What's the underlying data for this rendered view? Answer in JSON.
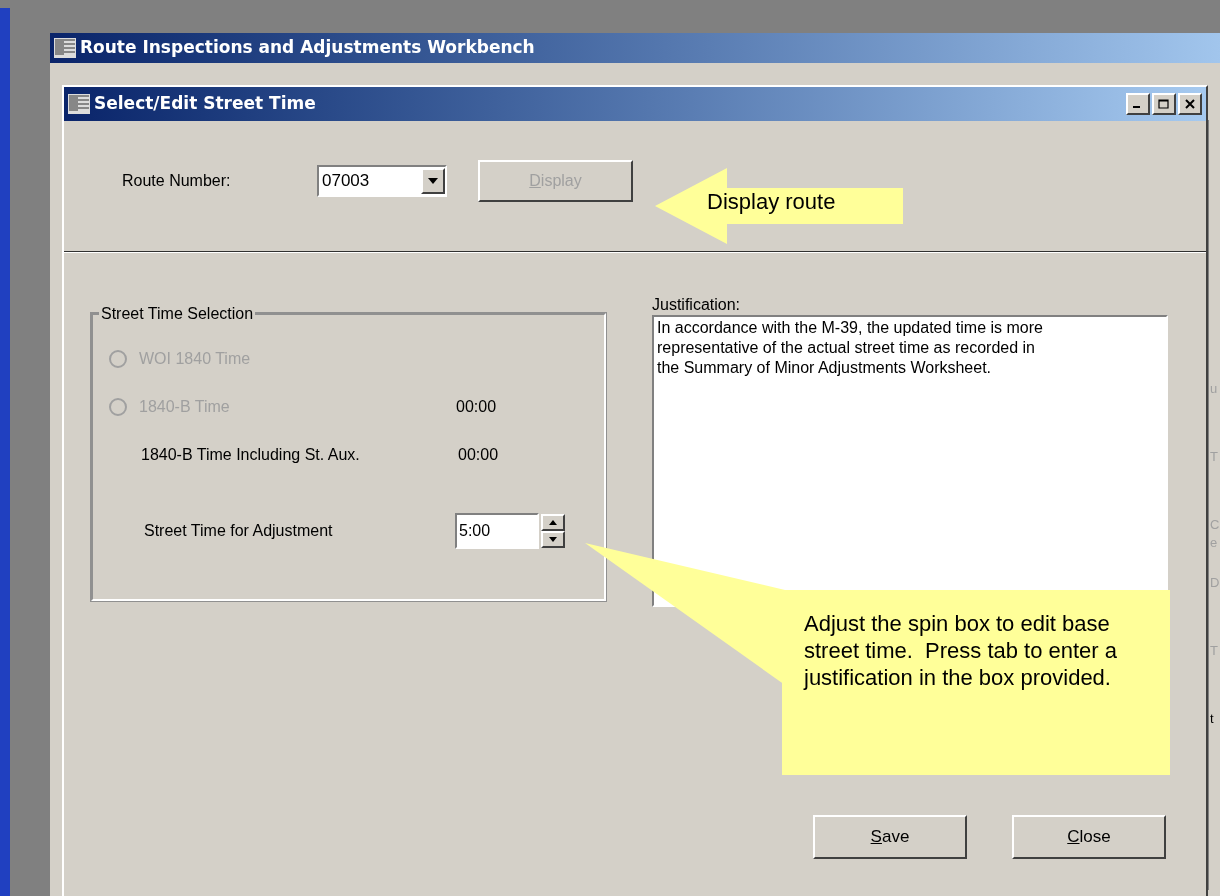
{
  "outer_window": {
    "title": "Route Inspections and Adjustments Workbench"
  },
  "dialog": {
    "title": "Select/Edit Street Time",
    "route_number": {
      "label": "Route Number:",
      "value": "07003"
    },
    "display_button": {
      "label": "Display",
      "disabled": true
    },
    "street_time_selection": {
      "legend": "Street Time Selection",
      "items": [
        {
          "kind": "radio",
          "label": "WOI 1840 Time",
          "selected": false,
          "disabled": true
        },
        {
          "kind": "radio",
          "label": "1840-B Time",
          "value": "00:00",
          "selected": false,
          "disabled": true
        },
        {
          "kind": "text",
          "label": "1840-B Time Including St. Aux.",
          "value": "00:00"
        },
        {
          "kind": "spin",
          "label": "Street Time for Adjustment",
          "value": "5:00"
        }
      ]
    },
    "justification": {
      "label": "Justification:",
      "value": "In accordance with the M-39, the updated time is more representative of the actual street time as recorded in the Summary of Minor Adjustments Worksheet."
    },
    "buttons": [
      {
        "label": "Save"
      },
      {
        "label": "Close"
      }
    ]
  },
  "background_window": {
    "fragments": [
      "u",
      "T",
      "C",
      "e",
      "D",
      "T",
      "t"
    ]
  },
  "callouts": [
    {
      "kind": "arrow",
      "text": "Display route"
    },
    {
      "kind": "note",
      "text": "Adjust the spin box to edit base street time.  Press tab to enter a justification in the box provided."
    }
  ]
}
